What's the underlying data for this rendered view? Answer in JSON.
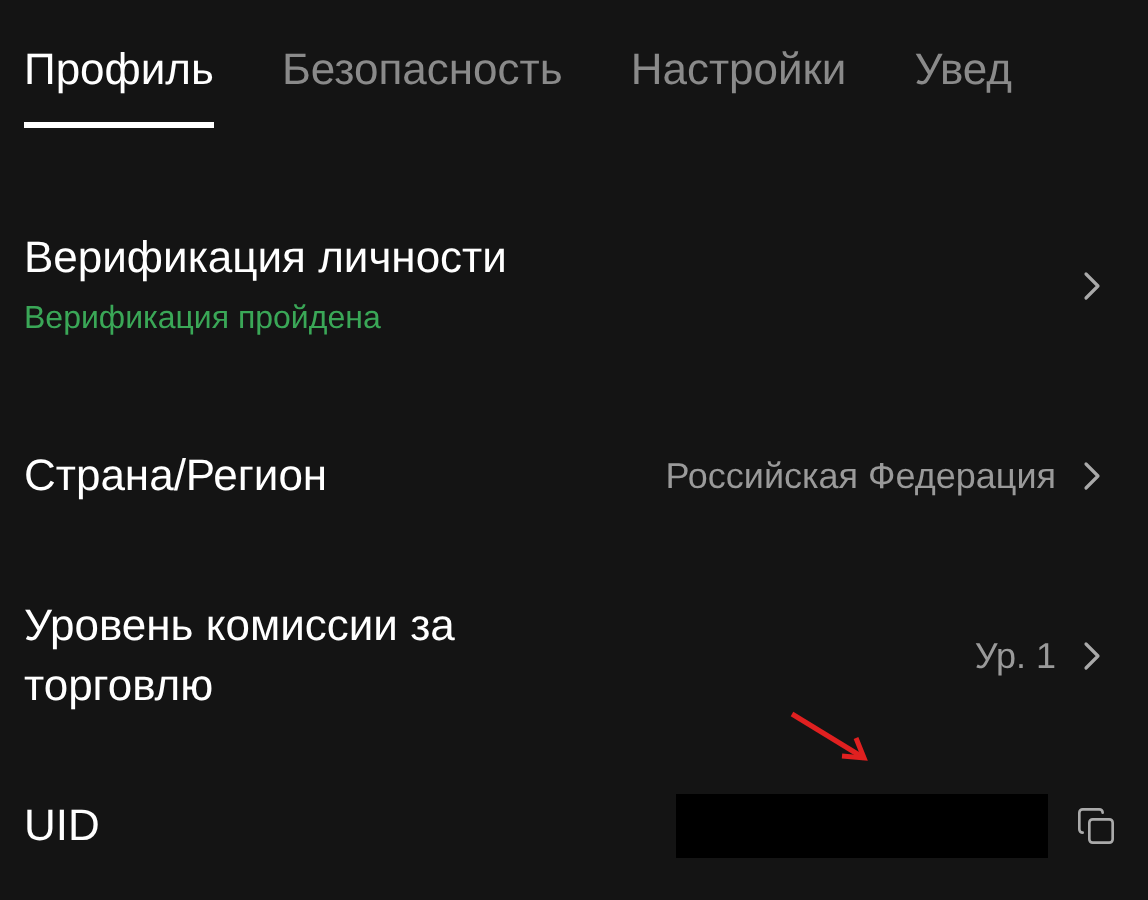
{
  "tabs": [
    {
      "label": "Профиль",
      "selected": true
    },
    {
      "label": "Безопасность",
      "selected": false
    },
    {
      "label": "Настройки",
      "selected": false
    },
    {
      "label": "Увед",
      "selected": false
    }
  ],
  "rows": [
    {
      "kind": "status",
      "title": "Верификация личности",
      "status": "Верификация пройдена"
    },
    {
      "kind": "value",
      "title": "Страна/Регион",
      "value": "Российская Федерация"
    },
    {
      "kind": "value",
      "title": "Уровень комиссии за торговлю",
      "value": "Ур. 1"
    },
    {
      "kind": "copy",
      "title": "UID"
    }
  ]
}
